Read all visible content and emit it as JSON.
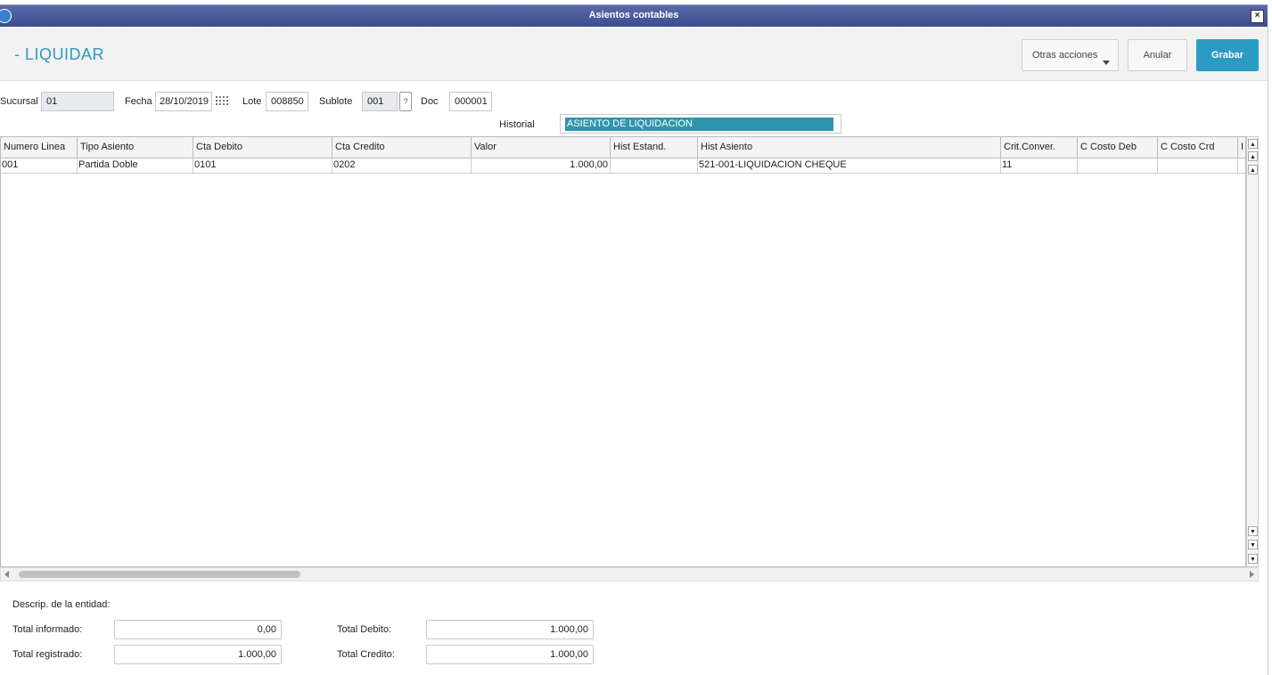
{
  "window": {
    "title": "Asientos contables",
    "close_symbol": "×"
  },
  "header": {
    "page_title": "- LIQUIDAR",
    "buttons": {
      "otras_acciones": "Otras acciones",
      "anular": "Anular",
      "grabar": "Grabar"
    }
  },
  "form": {
    "sucursal": {
      "label": "Sucursal",
      "value": "01"
    },
    "fecha": {
      "label": "Fecha",
      "value": "28/10/2019"
    },
    "lote": {
      "label": "Lote",
      "value": "008850"
    },
    "sublote": {
      "label": "Sublote",
      "value": "001",
      "help": "?"
    },
    "doc": {
      "label": "Doc",
      "value": "000001"
    },
    "historial": {
      "label": "Historial",
      "value": "ASIENTO DE LIQUIDACION"
    }
  },
  "grid": {
    "columns": [
      "Numero Linea",
      "Tipo Asiento",
      "Cta Debito",
      "Cta Credito",
      "Valor",
      "Hist Estand.",
      "Hist Asiento",
      "Crit.Conver.",
      "C Costo Deb",
      "C Costo Crd",
      "I"
    ],
    "rows": [
      [
        "001",
        "Partida Doble",
        "0101",
        "0202",
        "1.000,00",
        "",
        "521-001-LIQUIDACION CHEQUE",
        "11",
        "",
        "",
        ""
      ]
    ]
  },
  "footer": {
    "descrip_label": "Descrip. de la entidad:",
    "total_informado": {
      "label": "Total informado:",
      "value": "0,00"
    },
    "total_registrado": {
      "label": "Total registrado:",
      "value": "1.000,00"
    },
    "total_debito": {
      "label": "Total Debito:",
      "value": "1.000,00"
    },
    "total_credito": {
      "label": "Total Credito:",
      "value": "1.000,00"
    }
  },
  "icons": {
    "app": "app-icon",
    "calendar": "calendar-icon",
    "scroll_top": "scroll-top-icon",
    "page_up": "page-up-icon",
    "row_up": "row-up-icon",
    "row_down": "row-down-icon",
    "page_down": "page-down-icon",
    "scroll_bottom": "scroll-bottom-icon"
  },
  "colors": {
    "accent": "#2a9cc4",
    "titlebar": "#3c4d8e",
    "selection": "#2e95ad"
  }
}
